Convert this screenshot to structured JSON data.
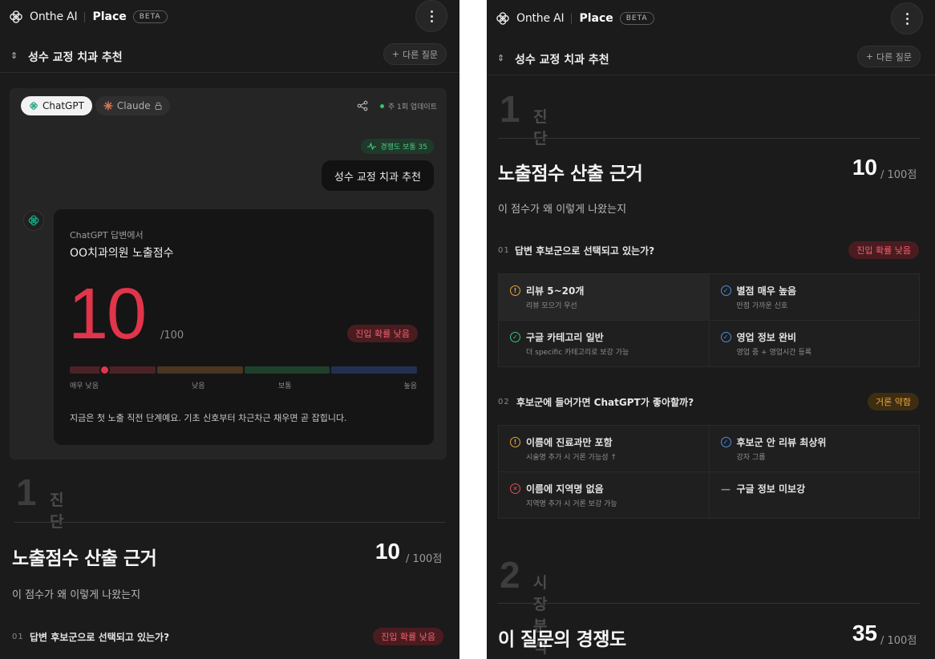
{
  "header": {
    "brand": "Onthe AI",
    "product": "Place",
    "beta": "BETA"
  },
  "question_bar": {
    "title": "성수 교정 치과 추천",
    "other_question": "다른 질문"
  },
  "result_card": {
    "tabs": [
      {
        "label": "ChatGPT",
        "active": true
      },
      {
        "label": "Claude",
        "active": false,
        "locked": true
      }
    ],
    "update_text": "주 1회 업데이트",
    "competition_badge": "경쟁도 보통 35",
    "user_query": "성수 교정 치과 추천",
    "answer_source": "ChatGPT 답변에서",
    "clinic_title": "OO치과의원 노출점수",
    "score": "10",
    "score_max": "/100",
    "score_value_pct": 10,
    "entry_badge": "진입 확률 낮음",
    "levels": [
      "매우 낮음",
      "낮음",
      "보통",
      "높음"
    ],
    "message": "지금은 첫 노출 직전 단계예요. 기초 신호부터 차근차근 채우면 곧 잡힙니다."
  },
  "section1": {
    "num": "1",
    "name": "진단",
    "heading": "노출점수 산출 근거",
    "score": "10",
    "score_unit": "/ 100점",
    "desc": "이 점수가 왜 이렇게 나왔는지",
    "q1": {
      "idx": "01",
      "text": "답변 후보군으로 선택되고 있는가?",
      "badge": "진입 확률 낮음",
      "items": [
        {
          "title": "리뷰 5~20개",
          "sub": "리뷰 모으기 우선",
          "status": "warning",
          "icon": "exclamation-icon"
        },
        {
          "title": "별점 매우 높음",
          "sub": "만점 가까운 신호",
          "status": "good",
          "icon": "check-icon"
        },
        {
          "title": "구글 카테고리 일반",
          "sub": "더 specific 카테고리로 보강 가능",
          "status": "ok",
          "icon": "check-icon"
        },
        {
          "title": "영업 정보 완비",
          "sub": "영업 중 + 영업시간 등록",
          "status": "good",
          "icon": "check-icon"
        }
      ]
    },
    "q2": {
      "idx": "02",
      "text": "후보군에 들어가면 ChatGPT가 좋아할까?",
      "badge": "거론 약함",
      "items": [
        {
          "title": "이름에 진료과만 포함",
          "sub": "시술명 추가 시 거론 가능성 ↑",
          "status": "warning",
          "icon": "exclamation-icon"
        },
        {
          "title": "후보군 안 리뷰 최상위",
          "sub": "강자 그룹",
          "status": "good",
          "icon": "check-icon"
        },
        {
          "title": "이름에 지역명 없음",
          "sub": "지역명 추가 시 거론 보강 가능",
          "status": "bad",
          "icon": "x-icon"
        },
        {
          "title": "구글 정보 미보강",
          "sub": "",
          "status": "none",
          "icon": "dash-icon"
        }
      ]
    }
  },
  "section2": {
    "num": "2",
    "name": "시장 분석",
    "heading": "이 질문의 경쟁도",
    "score": "35",
    "score_unit": "/ 100점"
  },
  "colors": {
    "bg": "#1b1b1b",
    "score_red": "#e0354a",
    "green": "#3ec27a",
    "blue": "#4a90e2",
    "amber": "#e6a23c"
  }
}
